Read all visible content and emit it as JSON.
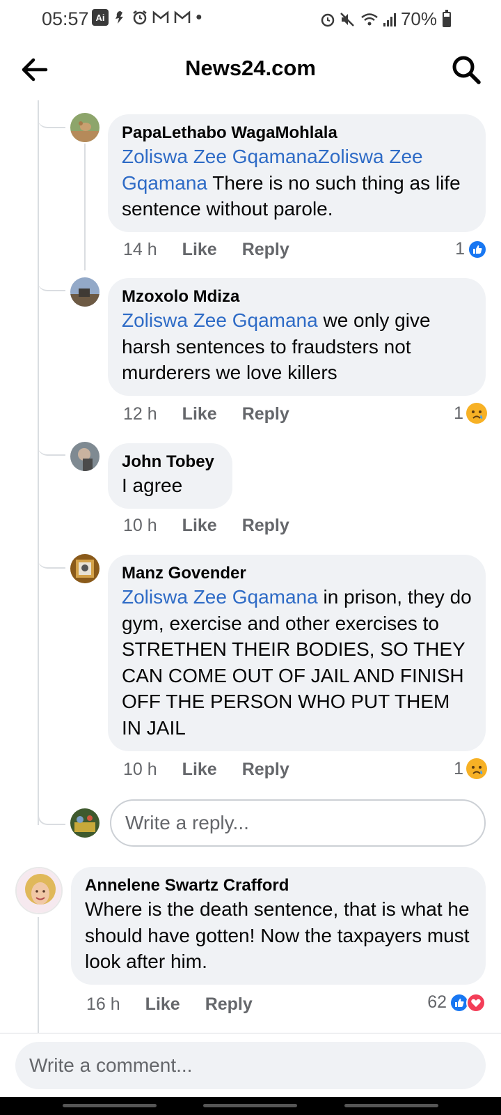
{
  "status_bar": {
    "time": "05:57",
    "ai_badge": "Ai",
    "battery": "70%",
    "battery_level": 0.7
  },
  "header": {
    "title": "News24.com",
    "back_icon": "arrow-left-icon",
    "search_icon": "search-icon"
  },
  "comments": [
    {
      "author": "PapaLethabo WagaMohlala",
      "mention": "Zoliswa Zee GqamanaZoliswa Zee Gqamana",
      "text": " There is no such thing as life sentence  without parole.",
      "time": "14 h",
      "like": "Like",
      "reply": "Reply",
      "reaction_count": "1",
      "reaction": "like"
    },
    {
      "author": "Mzoxolo Mdiza",
      "mention": "Zoliswa Zee Gqamana",
      "text": " we only give harsh sentences to fraudsters not murderers we love killers",
      "time": "12 h",
      "like": "Like",
      "reply": "Reply",
      "reaction_count": "1",
      "reaction": "sad"
    },
    {
      "author": "John Tobey",
      "mention": "",
      "text": "I agree",
      "time": "10 h",
      "like": "Like",
      "reply": "Reply"
    },
    {
      "author": "Manz Govender",
      "mention": "Zoliswa Zee Gqamana",
      "text": " in prison, they do gym, exercise and other exercises to STRETHEN THEIR BODIES, SO THEY CAN COME OUT OF JAIL AND FINISH OFF THE PERSON WHO PUT THEM IN JAIL",
      "time": "10 h",
      "like": "Like",
      "reply": "Reply",
      "reaction_count": "1",
      "reaction": "sad"
    },
    {
      "author": "Annelene Swartz Crafford",
      "mention": "",
      "text": "Where is the death sentence, that is what he should have gotten! Now the taxpayers must look after him.",
      "time": "16 h",
      "like": "Like",
      "reply": "Reply",
      "reaction_count": "62",
      "reaction": "like-love"
    }
  ],
  "reply_input": {
    "placeholder": "Write a reply..."
  },
  "composer": {
    "placeholder": "Write a comment..."
  },
  "colors": {
    "mention": "#2e6bc6",
    "like_blue": "#1877f2",
    "love_red": "#f33e58",
    "bubble": "#f0f2f5"
  }
}
